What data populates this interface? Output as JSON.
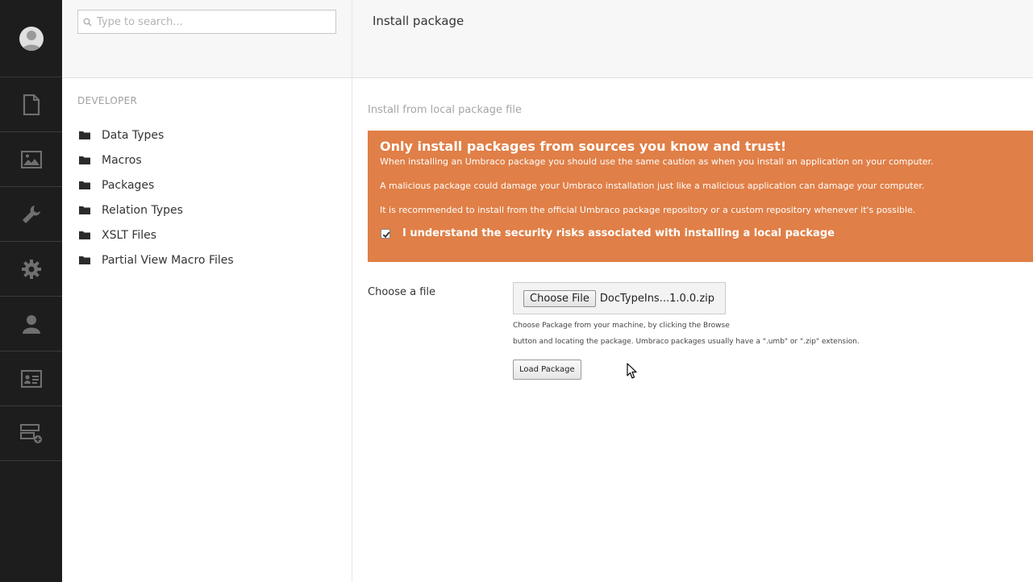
{
  "search": {
    "placeholder": "Type to search..."
  },
  "sections": [
    {
      "icon": "document-icon"
    },
    {
      "icon": "media-icon"
    },
    {
      "icon": "wrench-icon"
    },
    {
      "icon": "gear-icon"
    },
    {
      "icon": "user-icon"
    },
    {
      "icon": "member-card-icon"
    },
    {
      "icon": "forms-icon"
    }
  ],
  "tree": {
    "title": "DEVELOPER",
    "items": [
      {
        "label": "Data Types"
      },
      {
        "label": "Macros"
      },
      {
        "label": "Packages"
      },
      {
        "label": "Relation Types"
      },
      {
        "label": "XSLT Files"
      },
      {
        "label": "Partial View Macro Files"
      }
    ]
  },
  "main": {
    "title": "Install package",
    "subtitle": "Install from local package file",
    "warning": {
      "heading": "Only install packages from sources you know and trust!",
      "p1": "When installing an Umbraco package you should use the same caution as when you install an application on your computer.",
      "p2": "A malicious package could damage your Umbraco installation just like a malicious application can damage your computer.",
      "p3": "It is recommended to install from the official Umbraco package repository or a custom repository whenever it's possible.",
      "agree_label": "I understand the security risks associated with installing a local package",
      "agree_checked": true
    },
    "file": {
      "label": "Choose a file",
      "button": "Choose File",
      "filename": "DocTypeIns...1.0.0.zip",
      "help1": "Choose Package from your machine, by clicking the Browse",
      "help2": "button and locating the package. Umbraco packages usually have a \".umb\" or \".zip\" extension."
    },
    "load_button": "Load Package"
  },
  "colors": {
    "warning": "#e07f47",
    "appbar": "#1d1d1d"
  }
}
